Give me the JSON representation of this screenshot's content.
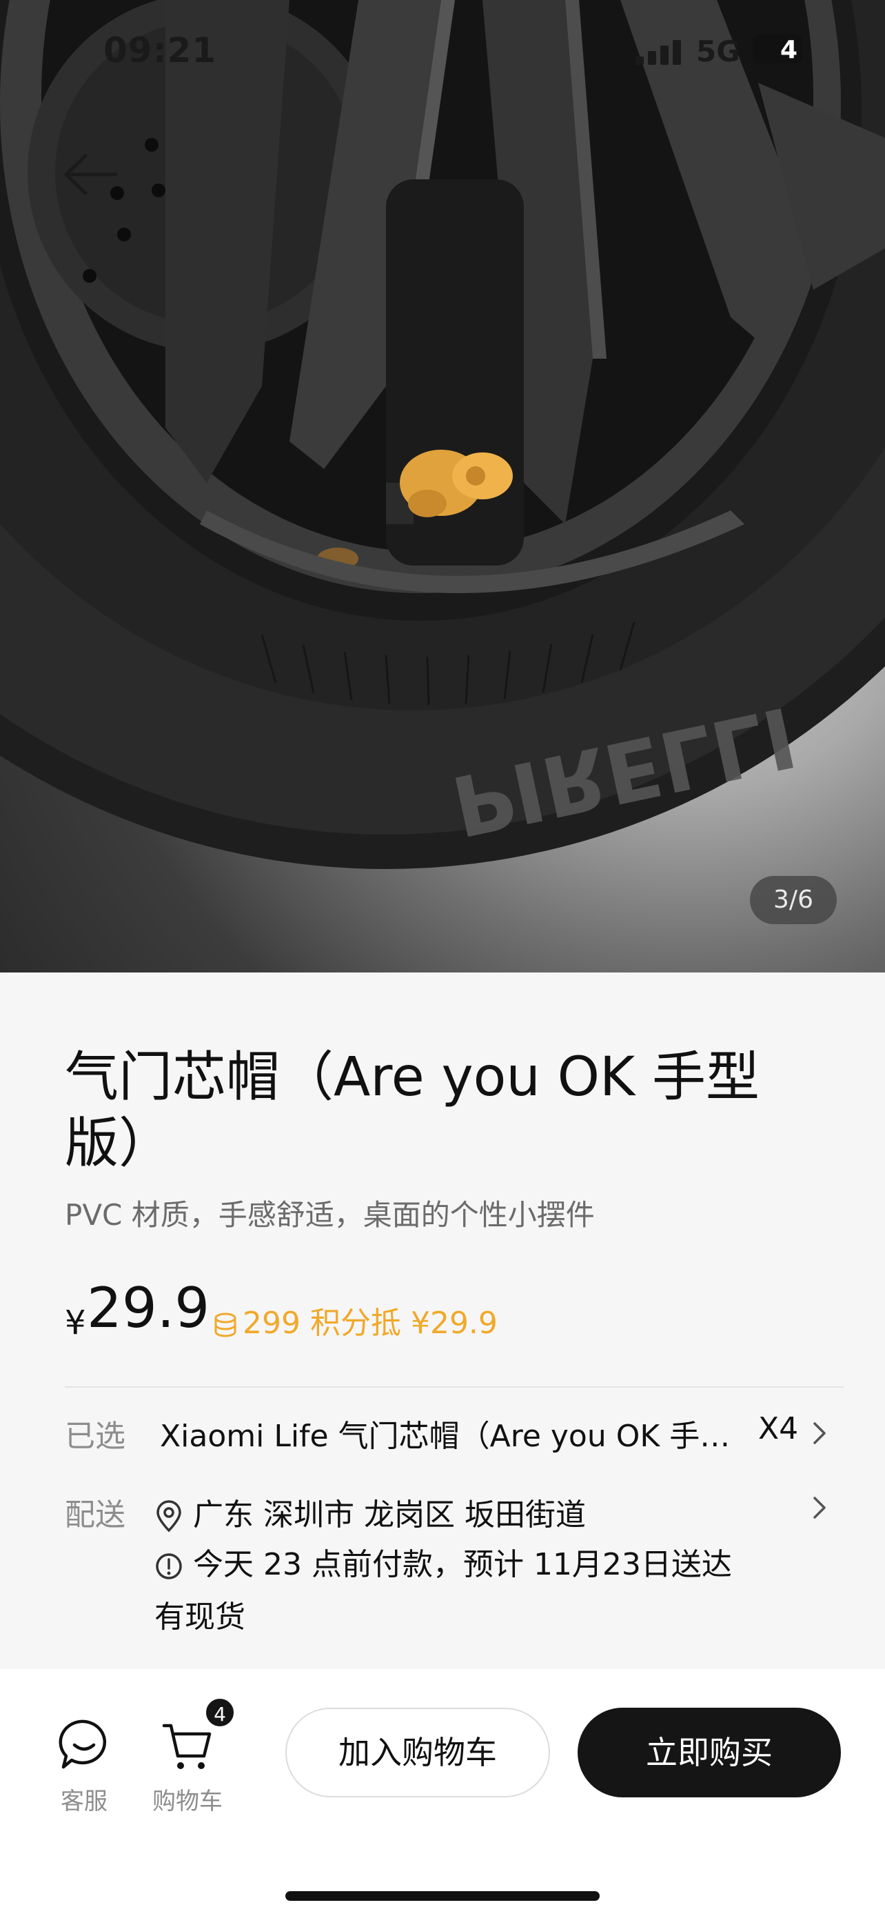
{
  "status_bar": {
    "time": "09:21",
    "network": "5G",
    "battery": "4"
  },
  "hero": {
    "pager": "3/6",
    "tire_brand": "PIRELLI",
    "image_icon": "tire-wheel-with-valve-cap-image"
  },
  "product": {
    "title": "气门芯帽（Are you OK 手型版）",
    "subtitle": "PVC 材质，手感舒适，桌面的个性小摆件",
    "price_currency": "¥",
    "price": "29.9",
    "points_text": "299 积分抵 ¥29.9",
    "points_color": "#f0a92a"
  },
  "selected": {
    "label": "已选",
    "value": "Xiaomi Life 气门芯帽（Are you OK 手型版）",
    "quantity": "X4"
  },
  "delivery": {
    "label": "配送",
    "address": "广东 深圳市 龙岗区 坂田街道",
    "notice": "今天 23 点前付款，预计 11月23日送达",
    "stock": "有现货"
  },
  "bottom_bar": {
    "service_label": "客服",
    "cart_label": "购物车",
    "cart_count": "4",
    "add_to_cart": "加入购物车",
    "buy_now": "立即购买",
    "buy_color": "#151515"
  }
}
